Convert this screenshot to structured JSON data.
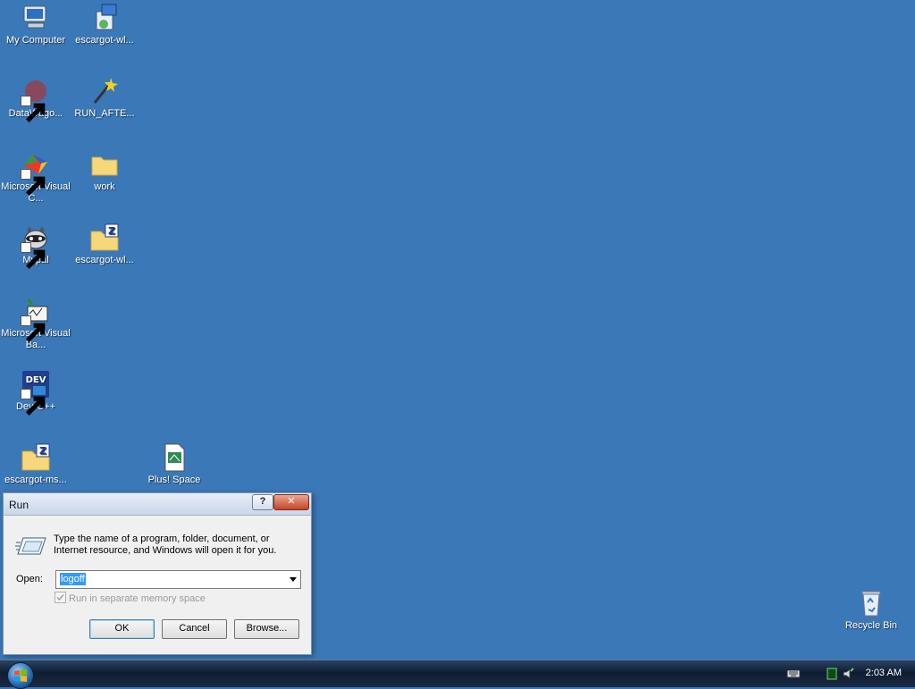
{
  "desktop": {
    "icons": [
      {
        "label": "My Computer"
      },
      {
        "label": "escargot-wl..."
      },
      {
        "label": "DataWago..."
      },
      {
        "label": "RUN_AFTE..."
      },
      {
        "label": "Microsoft Visual C..."
      },
      {
        "label": "work"
      },
      {
        "label": "Mypal"
      },
      {
        "label": "escargot-wl..."
      },
      {
        "label": "Microsoft Visual Ba..."
      },
      {
        "label": "Dev-C++"
      },
      {
        "label": "escargot-ms..."
      },
      {
        "label": "Plus! Space"
      },
      {
        "label": "Recycle Bin"
      }
    ]
  },
  "run_dialog": {
    "title": "Run",
    "help_symbol": "?",
    "close_symbol": "✕",
    "description": "Type the name of a program, folder, document, or Internet resource, and Windows will open it for you.",
    "open_label": "Open:",
    "open_value": "logoff",
    "checkbox_label": "Run in separate memory space",
    "checkbox_checked": true,
    "checkbox_enabled": false,
    "ok_label": "OK",
    "cancel_label": "Cancel",
    "browse_label": "Browse..."
  },
  "taskbar": {
    "clock": "2:03 AM",
    "tray_icons": [
      "keyboard-icon",
      "network-status-icon",
      "speaker-icon"
    ]
  },
  "colors": {
    "desktop_background": "#3b78b7",
    "selection": "#3399ff"
  }
}
